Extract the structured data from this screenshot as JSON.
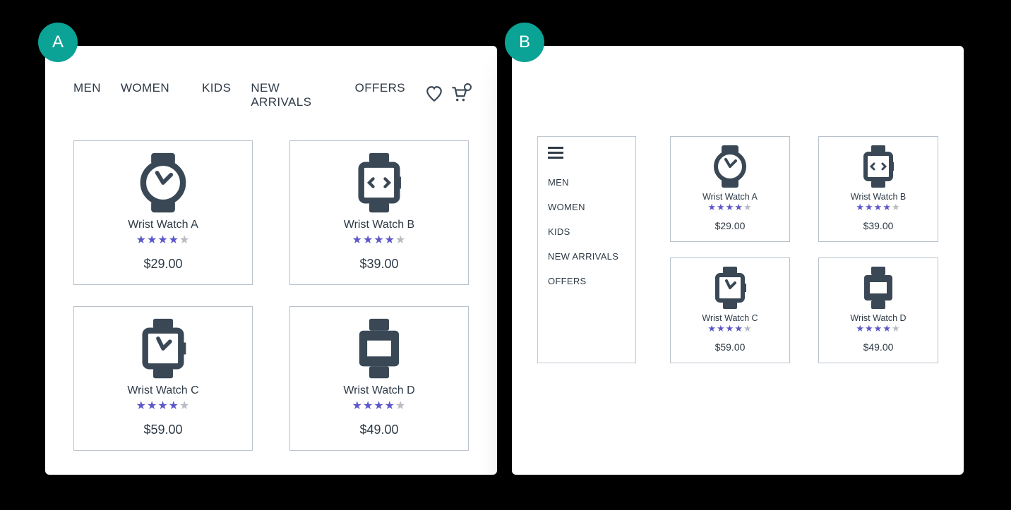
{
  "badge_a": "A",
  "badge_b": "B",
  "nav": {
    "items": [
      "MEN",
      "WOMEN",
      "KIDS",
      "NEW ARRIVALS",
      "OFFERS"
    ]
  },
  "products": [
    {
      "name": "Wrist Watch A",
      "price": "$29.00",
      "rating": 4,
      "icon": "watch-round"
    },
    {
      "name": "Wrist Watch B",
      "price": "$39.00",
      "rating": 4,
      "icon": "watch-digital"
    },
    {
      "name": "Wrist Watch C",
      "price": "$59.00",
      "rating": 4,
      "icon": "watch-square"
    },
    {
      "name": "Wrist Watch D",
      "price": "$49.00",
      "rating": 4,
      "icon": "watch-block"
    }
  ],
  "sidebar": {
    "items": [
      "MEN",
      "WOMEN",
      "KIDS",
      "NEW ARRIVALS",
      "OFFERS"
    ]
  }
}
